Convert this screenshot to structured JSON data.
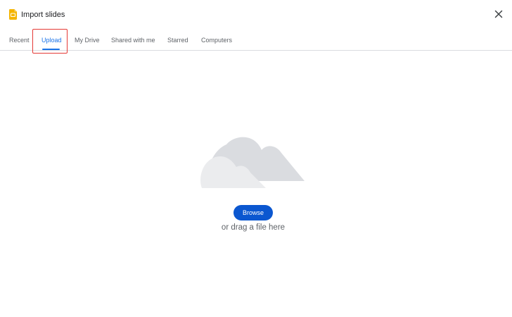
{
  "dialog": {
    "title": "Import slides",
    "app_icon": "google-slides-icon",
    "close_icon": "close-icon",
    "accent_color": "#1a73e8",
    "app_icon_color": "#f4b400"
  },
  "tabs": [
    {
      "label": "Recent",
      "active": false
    },
    {
      "label": "Upload",
      "active": true
    },
    {
      "label": "My Drive",
      "active": false
    },
    {
      "label": "Shared with me",
      "active": false
    },
    {
      "label": "Starred",
      "active": false
    },
    {
      "label": "Computers",
      "active": false
    }
  ],
  "upload": {
    "illustration_icon": "cloud-icon",
    "browse_label": "Browse",
    "drag_text": "or drag a file here",
    "button_color": "#0b57d0"
  }
}
